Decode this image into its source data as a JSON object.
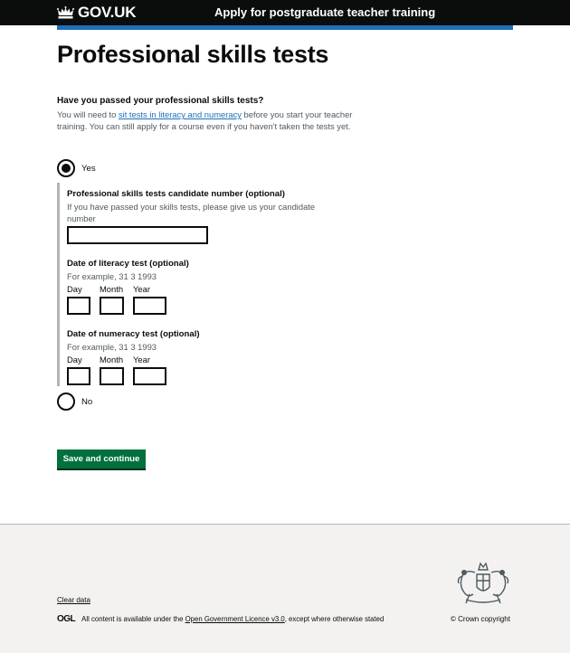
{
  "header": {
    "logo_text": "GOV.UK",
    "service_name": "Apply for postgraduate teacher training"
  },
  "page": {
    "title": "Professional skills tests"
  },
  "question": {
    "title": "Have you passed your professional skills tests?",
    "hint_before": "You will need to ",
    "hint_link": "sit tests in literacy and numeracy",
    "hint_after": " before you start your teacher training. You can still apply for a course even if you haven't taken the tests yet."
  },
  "options": {
    "yes": {
      "label": "Yes",
      "checked": true
    },
    "no": {
      "label": "No",
      "checked": false
    }
  },
  "conditional": {
    "candidate_number": {
      "label": "Professional skills tests candidate number (optional)",
      "hint": "If you have passed your skills tests, please give us your candidate number",
      "value": ""
    },
    "literacy_date": {
      "label": "Date of literacy test (optional)",
      "hint": "For example, 31 3 1993",
      "day_label": "Day",
      "month_label": "Month",
      "year_label": "Year"
    },
    "numeracy_date": {
      "label": "Date of numeracy test (optional)",
      "hint": "For example, 31 3 1993",
      "day_label": "Day",
      "month_label": "Month",
      "year_label": "Year"
    }
  },
  "actions": {
    "save_label": "Save and continue"
  },
  "footer": {
    "clear_data": "Clear data",
    "ogl_logo": "OGL",
    "licence_before": "All content is available under the ",
    "licence_link": "Open Government Licence v3.0",
    "licence_after": ", except where otherwise stated",
    "copyright": "© Crown copyright"
  },
  "colors": {
    "header_bg": "#0b0c0c",
    "brand_blue": "#1d70b8",
    "button_green": "#00703c",
    "footer_bg": "#f3f2f1"
  }
}
